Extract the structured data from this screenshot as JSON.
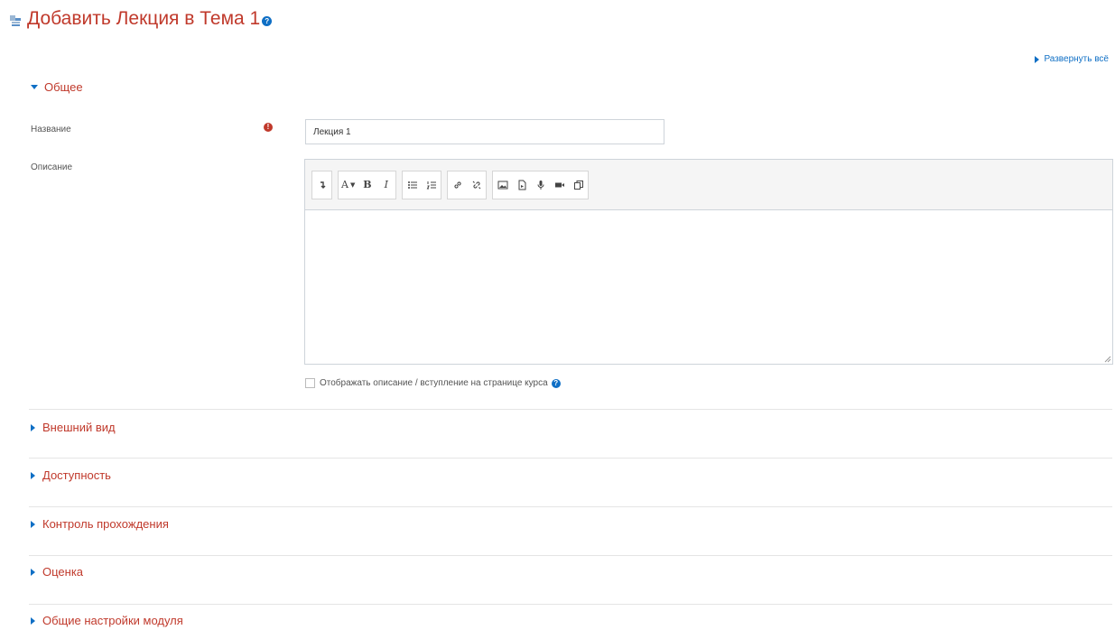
{
  "page": {
    "title": "Добавить Лекция в Тема 1",
    "help_glyph": "?"
  },
  "expand_all_label": "Развернуть всё",
  "sections": {
    "general": {
      "label": "Общее",
      "expanded": true
    },
    "appearance": {
      "label": "Внешний вид",
      "expanded": false
    },
    "availability": {
      "label": "Доступность",
      "expanded": false
    },
    "completion": {
      "label": "Контроль прохождения",
      "expanded": false
    },
    "grade": {
      "label": "Оценка",
      "expanded": false
    },
    "common_settings": {
      "label": "Общие настройки модуля",
      "expanded": false
    }
  },
  "form": {
    "name_label": "Название",
    "name_value": "Лекция 1",
    "required_glyph": "!",
    "description_label": "Описание",
    "description_value": "",
    "show_description_label": "Отображать описание / вступление на странице курса",
    "show_description_checked": false
  },
  "toolbar": {
    "font_size_label": "A",
    "bold_label": "B",
    "italic_label": "I"
  },
  "colors": {
    "accent_red": "#c0392b",
    "link_blue": "#0f6fc5"
  }
}
